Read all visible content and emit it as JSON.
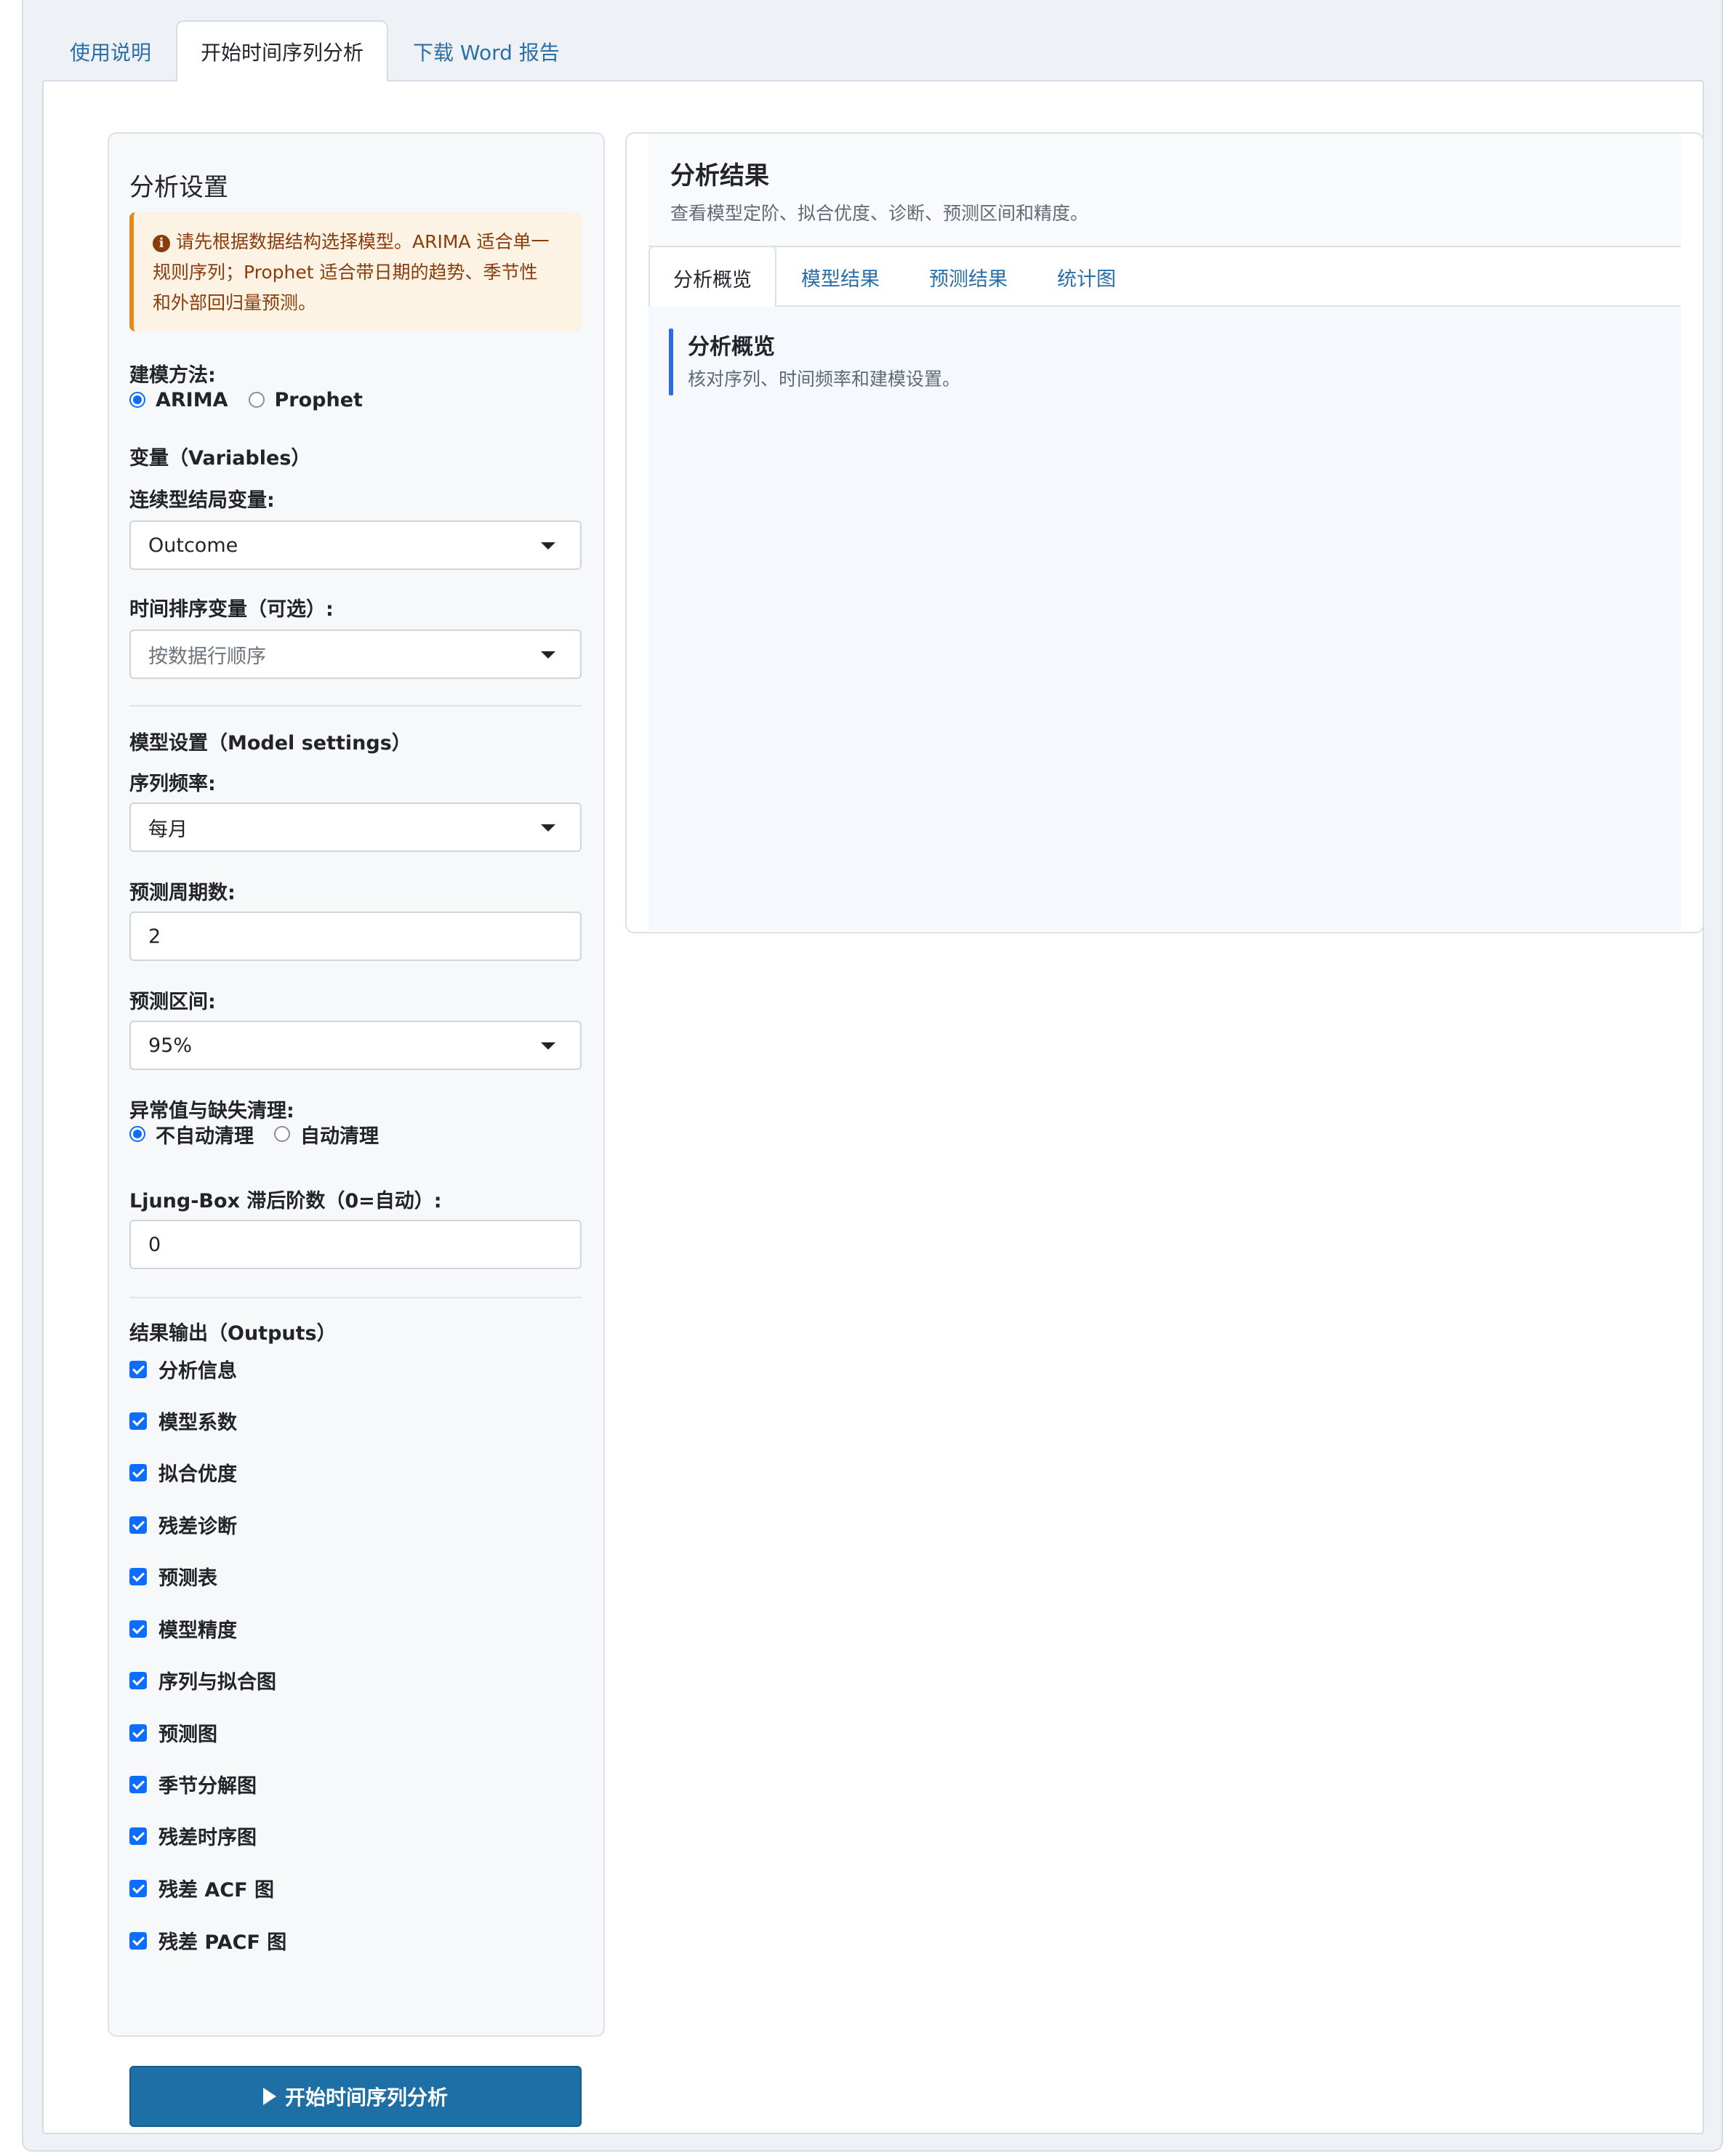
{
  "top_tabs": [
    {
      "label": "使用说明",
      "active": false
    },
    {
      "label": "开始时间序列分析",
      "active": true
    },
    {
      "label": "下载 Word 报告",
      "active": false
    }
  ],
  "settings": {
    "title": "分析设置",
    "alert_line1": "请先根据数据结构选择模型。ARIMA 适合单一",
    "alert_line2": "规则序列；Prophet 适合带日期的趋势、季节性",
    "alert_line3": "和外部回归量预测。",
    "method_label": "建模方法:",
    "method_options": [
      {
        "label": "ARIMA",
        "selected": true
      },
      {
        "label": "Prophet",
        "selected": false
      }
    ],
    "variables_section": "变量（Variables）",
    "outcome_label": "连续型结局变量:",
    "outcome_value": "Outcome",
    "time_label": "时间排序变量（可选）:",
    "time_placeholder": "按数据行顺序",
    "model_section": "模型设置（Model settings）",
    "freq_label": "序列频率:",
    "freq_value": "每月",
    "horizon_label": "预测周期数:",
    "horizon_value": "2",
    "interval_label": "预测区间:",
    "interval_value": "95%",
    "clean_label": "异常值与缺失清理:",
    "clean_options": [
      {
        "label": "不自动清理",
        "selected": true
      },
      {
        "label": "自动清理",
        "selected": false
      }
    ],
    "ljung_label": "Ljung-Box 滞后阶数（0=自动）:",
    "ljung_value": "0",
    "outputs_section": "结果输出（Outputs）",
    "outputs": [
      {
        "label": "分析信息",
        "checked": true
      },
      {
        "label": "模型系数",
        "checked": true
      },
      {
        "label": "拟合优度",
        "checked": true
      },
      {
        "label": "残差诊断",
        "checked": true
      },
      {
        "label": "预测表",
        "checked": true
      },
      {
        "label": "模型精度",
        "checked": true
      },
      {
        "label": "序列与拟合图",
        "checked": true
      },
      {
        "label": "预测图",
        "checked": true
      },
      {
        "label": "季节分解图",
        "checked": true
      },
      {
        "label": "残差时序图",
        "checked": true
      },
      {
        "label": "残差 ACF 图",
        "checked": true
      },
      {
        "label": "残差 PACF 图",
        "checked": true
      }
    ],
    "run_label": "开始时间序列分析"
  },
  "results": {
    "title": "分析结果",
    "subtitle": "查看模型定阶、拟合优度、诊断、预测区间和精度。",
    "tabs": [
      {
        "label": "分析概览",
        "active": true
      },
      {
        "label": "模型结果",
        "active": false
      },
      {
        "label": "预测结果",
        "active": false
      },
      {
        "label": "统计图",
        "active": false
      }
    ],
    "overview_title": "分析概览",
    "overview_subtitle": "核对序列、时间频率和建模设置。"
  }
}
